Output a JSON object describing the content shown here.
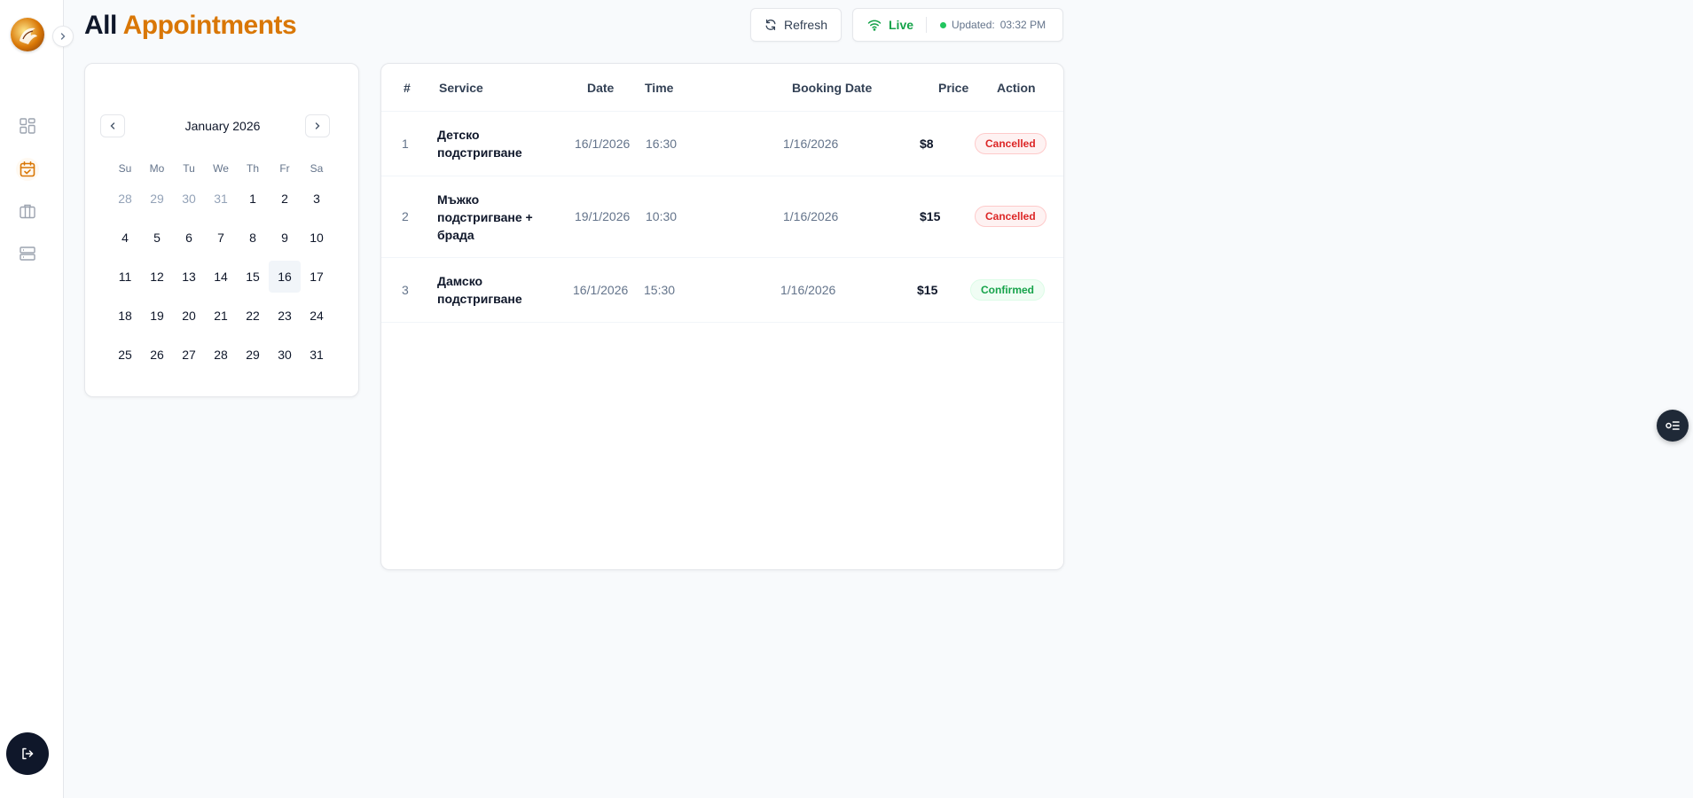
{
  "header": {
    "title_part1": "All",
    "title_part2": "Appointments",
    "refresh_label": "Refresh",
    "live_label": "Live",
    "updated_label": "Updated:",
    "updated_time": "03:32 PM"
  },
  "sidebar": {
    "items": [
      {
        "icon": "dashboard-grid-icon"
      },
      {
        "icon": "calendar-check-icon",
        "active": true
      },
      {
        "icon": "briefcase-icon"
      },
      {
        "icon": "server-stack-icon"
      }
    ],
    "logout_icon": "logout-icon"
  },
  "calendar": {
    "month_label": "January 2026",
    "weekdays": [
      "Su",
      "Mo",
      "Tu",
      "We",
      "Th",
      "Fr",
      "Sa"
    ],
    "days": [
      {
        "d": "28",
        "outside": true
      },
      {
        "d": "29",
        "outside": true
      },
      {
        "d": "30",
        "outside": true
      },
      {
        "d": "31",
        "outside": true
      },
      {
        "d": "1"
      },
      {
        "d": "2"
      },
      {
        "d": "3"
      },
      {
        "d": "4"
      },
      {
        "d": "5"
      },
      {
        "d": "6"
      },
      {
        "d": "7"
      },
      {
        "d": "8"
      },
      {
        "d": "9"
      },
      {
        "d": "10"
      },
      {
        "d": "11"
      },
      {
        "d": "12"
      },
      {
        "d": "13"
      },
      {
        "d": "14"
      },
      {
        "d": "15"
      },
      {
        "d": "16",
        "today": true
      },
      {
        "d": "17"
      },
      {
        "d": "18"
      },
      {
        "d": "19"
      },
      {
        "d": "20"
      },
      {
        "d": "21"
      },
      {
        "d": "22"
      },
      {
        "d": "23"
      },
      {
        "d": "24"
      },
      {
        "d": "25"
      },
      {
        "d": "26"
      },
      {
        "d": "27"
      },
      {
        "d": "28"
      },
      {
        "d": "29"
      },
      {
        "d": "30"
      },
      {
        "d": "31"
      }
    ]
  },
  "table": {
    "headers": {
      "num": "#",
      "service": "Service",
      "date": "Date",
      "time": "Time",
      "booking_date": "Booking Date",
      "price": "Price",
      "action": "Action"
    },
    "rows": [
      {
        "num": "1",
        "service": "Детско подстригване",
        "date": "16/1/2026",
        "time": "16:30",
        "booking_date": "1/16/2026",
        "price": "$8",
        "status": "Cancelled"
      },
      {
        "num": "2",
        "service": "Мъжко подстригване + брада",
        "date": "19/1/2026",
        "time": "10:30",
        "booking_date": "1/16/2026",
        "price": "$15",
        "status": "Cancelled"
      },
      {
        "num": "3",
        "service": "Дамско подстригване",
        "date": "16/1/2026",
        "time": "15:30",
        "booking_date": "1/16/2026",
        "price": "$15",
        "status": "Confirmed"
      }
    ]
  },
  "colors": {
    "accent": "#d97706",
    "live_green": "#16a34a",
    "cancelled_red": "#dc2626",
    "sidebar_dark": "#0f172a"
  }
}
